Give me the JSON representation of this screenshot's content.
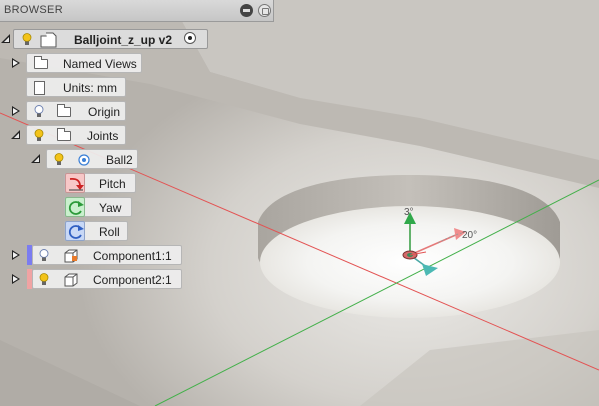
{
  "browser": {
    "title": "BROWSER",
    "root": {
      "label": "Balljoint_z_up v2"
    },
    "items": [
      {
        "label": "Named Views"
      },
      {
        "label": "Units: mm"
      },
      {
        "label": "Origin"
      },
      {
        "label": "Joints"
      },
      {
        "label": "Ball2"
      },
      {
        "label": "Pitch"
      },
      {
        "label": "Yaw"
      },
      {
        "label": "Roll"
      },
      {
        "label": "Component1:1"
      },
      {
        "label": "Component2:1"
      }
    ]
  },
  "viewport": {
    "triad": {
      "z_label": "3°",
      "x_label": "20°"
    }
  },
  "colors": {
    "accent_yellow": "#f3c319",
    "component1_bar": "#7b7cf0",
    "component2_bar": "#f0a3a3",
    "pitch": "#ef6c6c",
    "yaw": "#4cbf61",
    "roll": "#4c78d8"
  }
}
